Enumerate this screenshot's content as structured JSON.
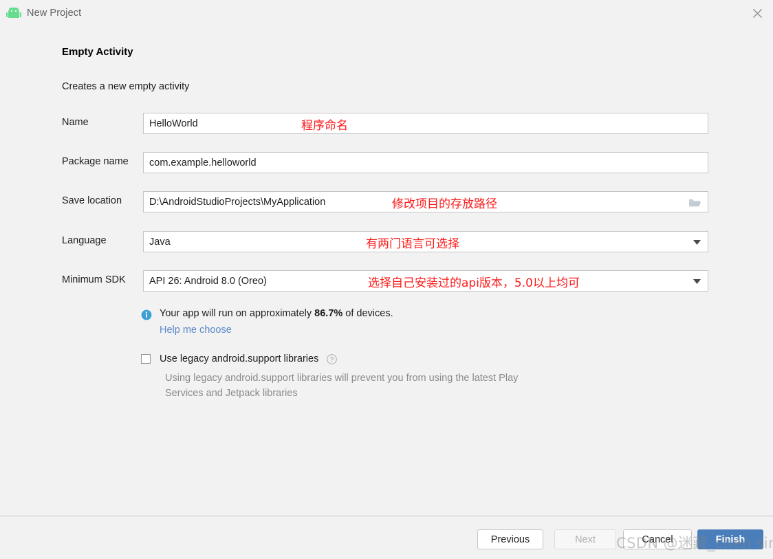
{
  "window": {
    "title": "New Project",
    "app_icon": "android-robot-icon",
    "close_icon": "close-icon"
  },
  "page": {
    "heading": "Empty Activity",
    "subheading": "Creates a new empty activity"
  },
  "form": {
    "rows": [
      {
        "label": "Name",
        "value": "HelloWorld",
        "type": "text",
        "annotation": "程序命名"
      },
      {
        "label": "Package name",
        "value": "com.example.helloworld",
        "type": "text",
        "annotation": ""
      },
      {
        "label": "Save location",
        "value": "D:\\AndroidStudioProjects\\MyApplication",
        "type": "path",
        "annotation": "修改项目的存放路径",
        "icon": "folder-icon"
      },
      {
        "label": "Language",
        "value": "Java",
        "type": "combo",
        "annotation": "有两门语言可选择",
        "icon": "chevron-down-icon"
      },
      {
        "label": "Minimum SDK",
        "value": "API 26: Android 8.0 (Oreo)",
        "type": "combo",
        "annotation": "选择自己安装过的api版本，5.0以上均可",
        "icon": "chevron-down-icon"
      }
    ]
  },
  "info": {
    "icon": "info-icon",
    "text_before": "Your app will run on approximately ",
    "percentage": "86.7%",
    "text_after": " of devices.",
    "help_link": "Help me choose"
  },
  "legacy": {
    "checked": false,
    "label": "Use legacy android.support libraries",
    "help_icon": "question-mark-icon",
    "description": "Using legacy android.support libraries will prevent you from using the latest Play Services and Jetpack libraries"
  },
  "footer": {
    "previous": "Previous",
    "next": "Next",
    "cancel": "Cancel",
    "finish": "Finish"
  },
  "watermark": "CSDN @迷藏_chen sir",
  "colors": {
    "accent": "#4a7ebb",
    "annotation_red": "#fc1b1b",
    "link_blue": "#5a87c9",
    "android_green": "#66dd8e",
    "background": "#f2f2f2"
  }
}
